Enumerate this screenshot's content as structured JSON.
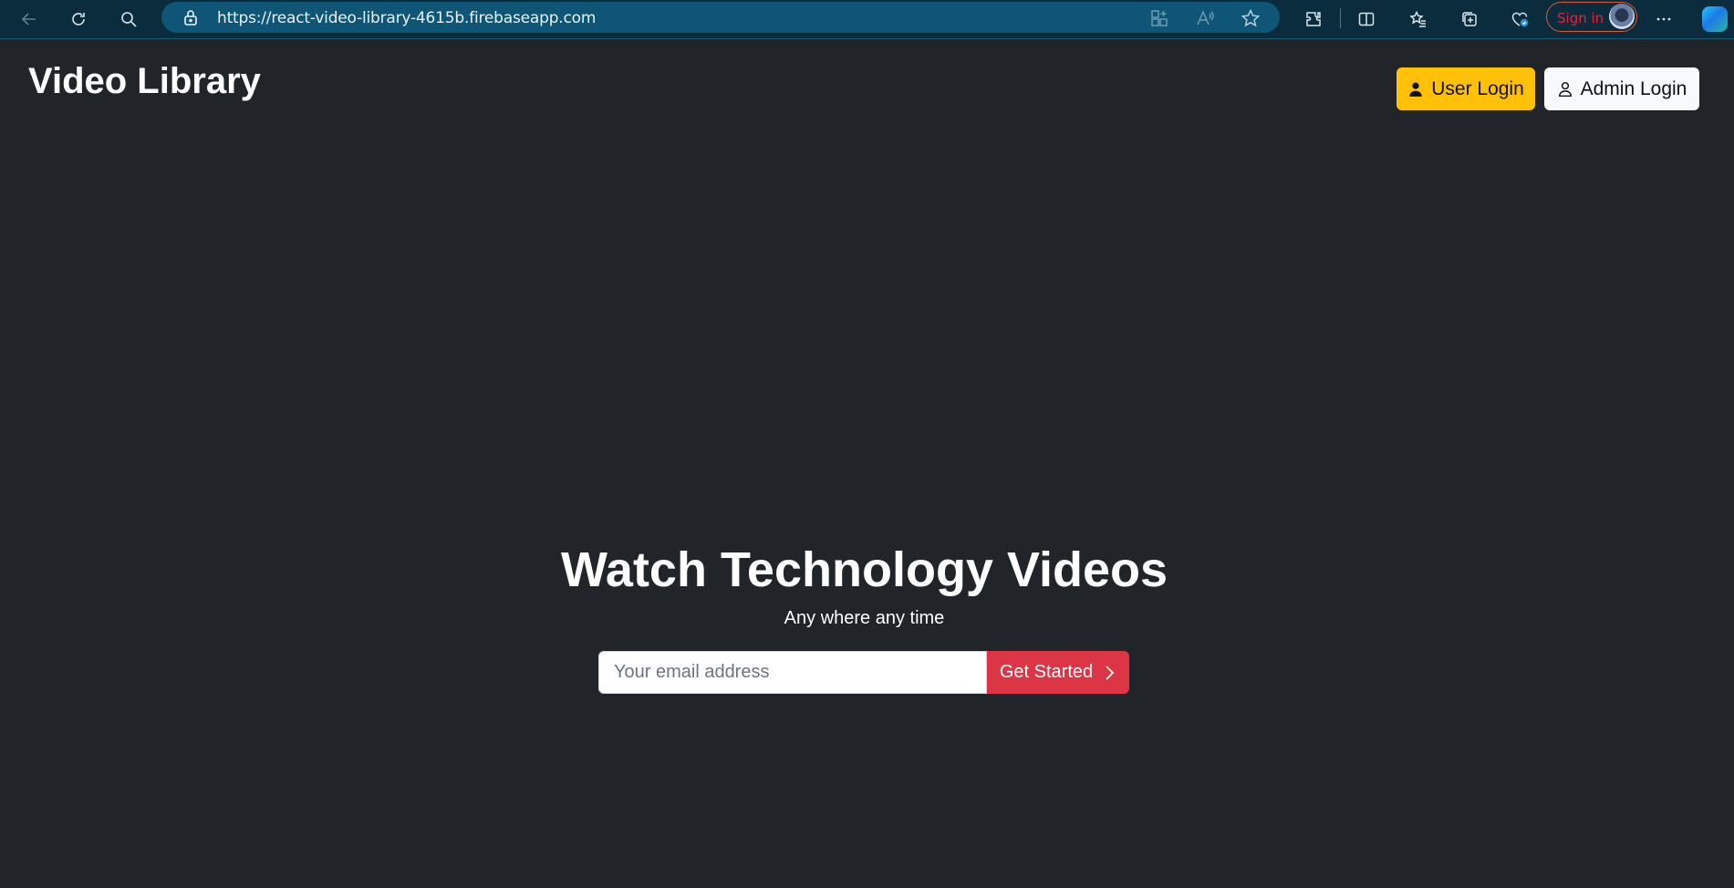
{
  "browser": {
    "url": "https://react-video-library-4615b.firebaseapp.com",
    "sign_in_label": "Sign in"
  },
  "header": {
    "title": "Video Library",
    "user_login_label": "User Login",
    "admin_login_label": "Admin Login"
  },
  "hero": {
    "title": "Watch Technology Videos",
    "subtitle": "Any where any time",
    "email_placeholder": "Your email address",
    "email_value": "",
    "get_started_label": "Get Started"
  },
  "colors": {
    "page_background": "#212529",
    "user_login_button": "#ffc107",
    "admin_login_button": "#f8f9fa",
    "get_started_button": "#dc3545",
    "browser_bar": "#0b2c3d",
    "address_bar": "#0f5576"
  },
  "icons": {
    "back": "arrow-left-icon",
    "refresh": "refresh-icon",
    "search": "search-icon",
    "lock": "lock-icon",
    "user_login": "person-fill-icon",
    "admin_login": "person-outline-icon",
    "get_started": "chevron-right-icon"
  }
}
